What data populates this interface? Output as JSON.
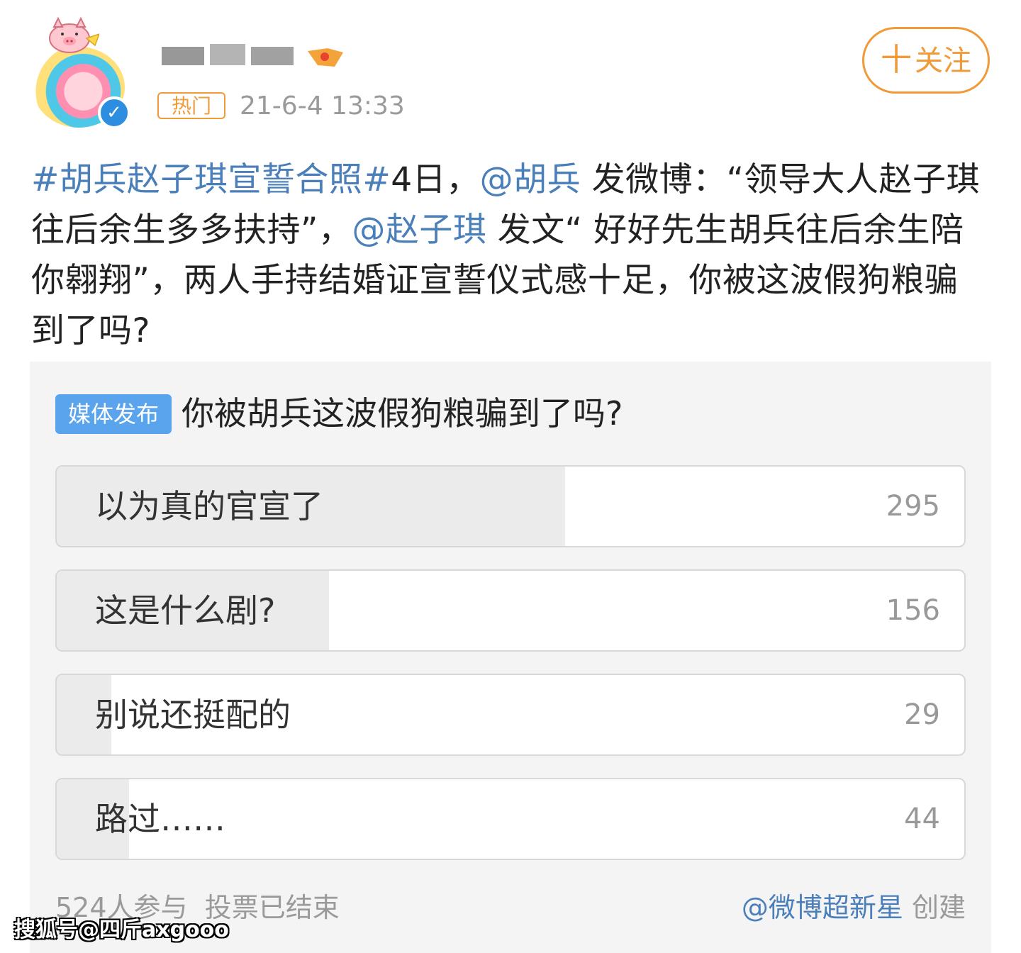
{
  "header": {
    "hot_label": "热门",
    "time": "21-6-4 13:33",
    "follow_plus": "十",
    "follow_label": "关注"
  },
  "post": {
    "hashtag": "#胡兵赵子琪宣誓合照#",
    "seg1": "4日，",
    "mention1": "@胡兵",
    "seg2": " 发微博：“领导大人赵子琪往后余生多多扶持”，",
    "mention2": "@赵子琪",
    "seg3": " 发文“ 好好先生胡兵往后余生陪你翱翔”，两人手持结婚证宣誓仪式感十足，你被这波假狗粮骗到了吗?"
  },
  "poll": {
    "badge": "媒体发布",
    "title": "你被胡兵这波假狗粮骗到了吗?",
    "options": [
      {
        "label": "以为真的官宣了",
        "count": "295",
        "fill": 0.56
      },
      {
        "label": "这是什么剧?",
        "count": "156",
        "fill": 0.3
      },
      {
        "label": "别说还挺配的",
        "count": "29",
        "fill": 0.06
      },
      {
        "label": "路过……",
        "count": "44",
        "fill": 0.08
      }
    ],
    "participants": "524人参与",
    "status": "投票已结束",
    "creator": "@微博超新星",
    "created": "创建"
  },
  "watermark": "搜狐号@四斤axgooo",
  "colors": {
    "accent_orange": "#f09a3a",
    "link_blue": "#4a7fba",
    "badge_blue": "#5aa4ee",
    "verified_blue": "#2d8de0"
  }
}
